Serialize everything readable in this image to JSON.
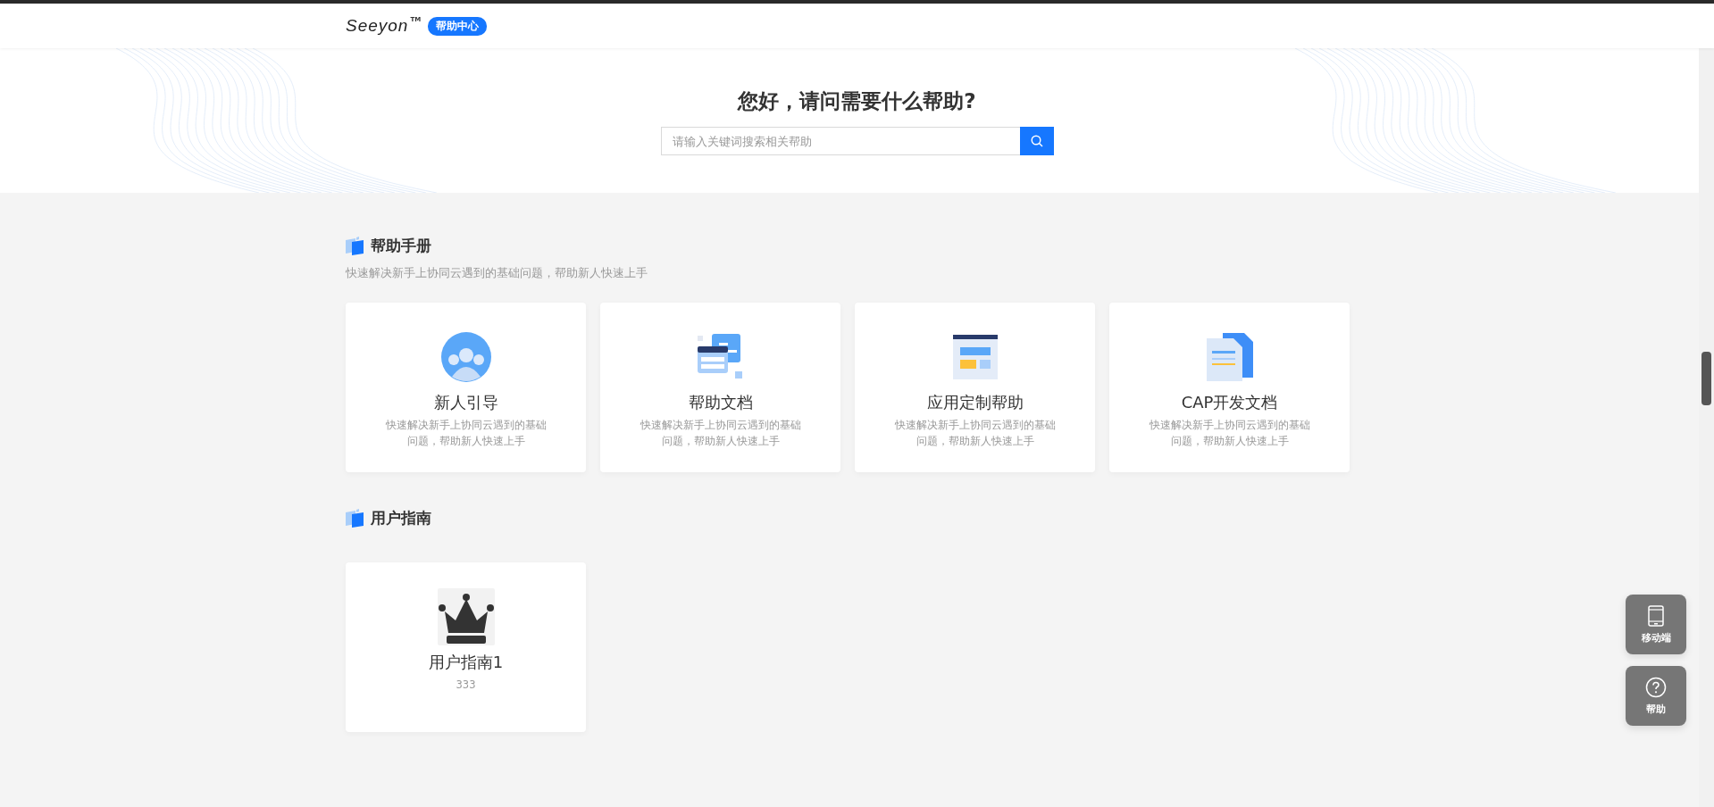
{
  "header": {
    "logo": "Seeyon",
    "trademark": "TM",
    "badge": "帮助中心"
  },
  "hero": {
    "title": "您好，请问需要什么帮助?",
    "search": {
      "placeholder": "请输入关键词搜索相关帮助"
    }
  },
  "sections": [
    {
      "title": "帮助手册",
      "subtitle": "快速解决新手上协同云遇到的基础问题，帮助新人快速上手",
      "cards": [
        {
          "kind": "people",
          "title": "新人引导",
          "description": "快速解决新手上协同云遇到的基础问题，帮助新人快速上手"
        },
        {
          "kind": "docs",
          "title": "帮助文档",
          "description": "快速解决新手上协同云遇到的基础问题，帮助新人快速上手"
        },
        {
          "kind": "window",
          "title": "应用定制帮助",
          "description": "快速解决新手上协同云遇到的基础问题，帮助新人快速上手"
        },
        {
          "kind": "files",
          "title": "CAP开发文档",
          "description": "快速解决新手上协同云遇到的基础问题，帮助新人快速上手"
        }
      ]
    },
    {
      "title": "用户指南",
      "cards": [
        {
          "kind": "crown",
          "title": "用户指南1",
          "description": "333"
        }
      ]
    }
  ],
  "float_buttons": [
    {
      "kind": "mobile",
      "label": "移动端"
    },
    {
      "kind": "help",
      "label": "帮助"
    }
  ]
}
